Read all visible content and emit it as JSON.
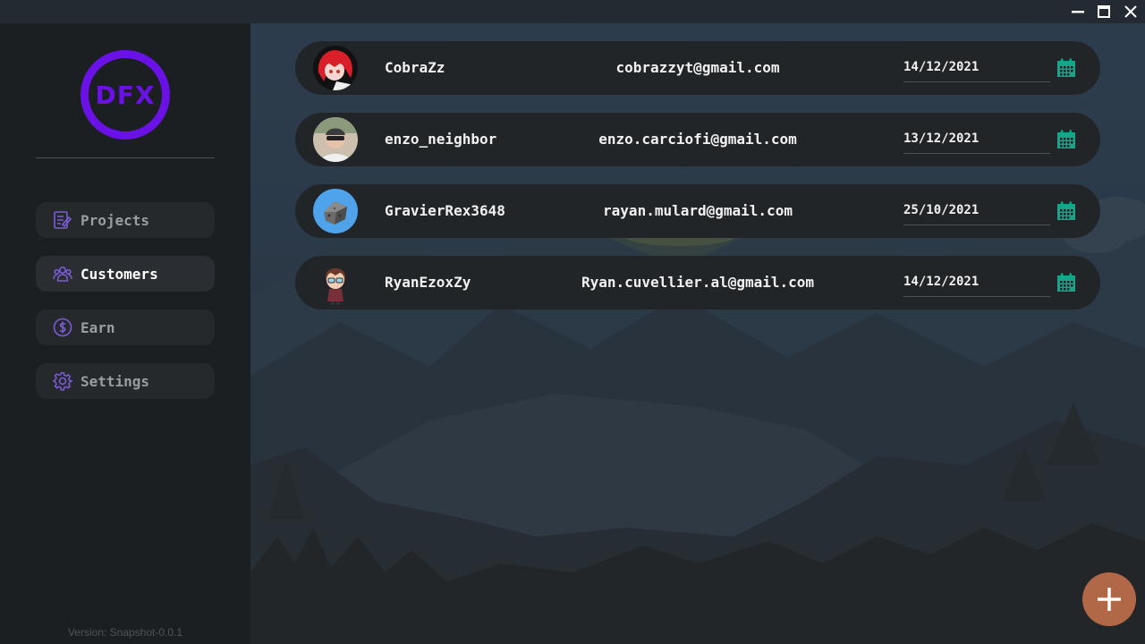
{
  "window": {
    "controls": [
      {
        "name": "minimize-icon"
      },
      {
        "name": "maximize-icon"
      },
      {
        "name": "close-icon"
      }
    ]
  },
  "sidebar": {
    "logo_text": "DFX",
    "logo_color": "#6a12e6",
    "items": [
      {
        "label": "Projects",
        "icon": "projects-icon",
        "active": false
      },
      {
        "label": "Customers",
        "icon": "customers-icon",
        "active": true
      },
      {
        "label": "Earn",
        "icon": "dollar-icon",
        "active": false
      },
      {
        "label": "Settings",
        "icon": "gear-icon",
        "active": false
      }
    ],
    "version": "Version: Snapshot-0.0.1"
  },
  "customers": [
    {
      "name": "CobraZz",
      "email": "cobrazzyt@gmail.com",
      "date": "14/12/2021",
      "avatar": "red-hair-anime-avatar"
    },
    {
      "name": "enzo_neighbor",
      "email": "enzo.carciofi@gmail.com",
      "date": "13/12/2021",
      "avatar": "photo-avatar"
    },
    {
      "name": "GravierRex3648",
      "email": "rayan.mulard@gmail.com",
      "date": "25/10/2021",
      "avatar": "gravel-block-avatar"
    },
    {
      "name": "RyanEzoxZy",
      "email": "Ryan.cuvellier.al@gmail.com",
      "date": "14/12/2021",
      "avatar": "cartoon-boy-avatar"
    }
  ],
  "fab": {
    "icon": "plus-icon",
    "color": "#b06846"
  },
  "colors": {
    "accent": "#6a12e6",
    "calendar": "#17a589",
    "nav_icon": "#8b5cf6"
  }
}
